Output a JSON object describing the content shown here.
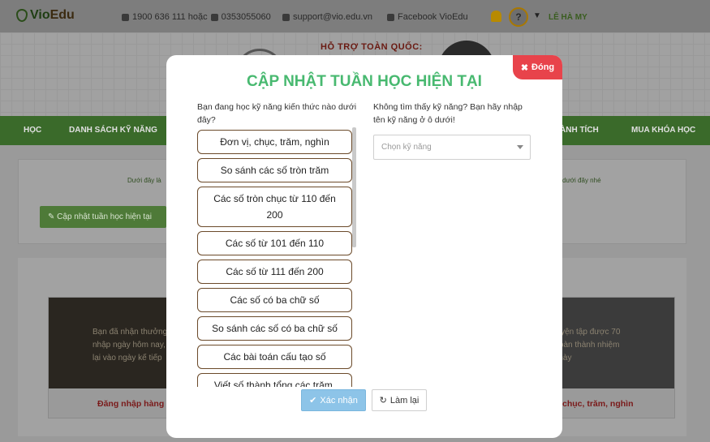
{
  "header": {
    "logo_vio": "Vio",
    "logo_edu": "Edu",
    "phone": "1900 636 111 hoặc",
    "mobile": "0353055060",
    "email": "support@vio.edu.vn",
    "facebook": "Facebook VioEdu",
    "help_mark": "?",
    "user_name": "LÊ HÀ MY"
  },
  "hero": {
    "banner_text": "HỖ TRỢ TOÀN QUỐC:"
  },
  "nav": {
    "items": [
      "HỌC",
      "DANH SÁCH KỸ NĂNG",
      "THÀNH TÍCH",
      "MUA KHÓA HỌC"
    ],
    "visible_items": [
      "HỌC",
      "DANH SÁCH KỸ NĂNG",
      "ÀNH TÍCH",
      "MUA KHÓA HỌC"
    ]
  },
  "content": {
    "intro_left": "Dưới đây là",
    "intro_right": "dưới đây nhé",
    "update_button": "Cập nhật tuần học hiện tại"
  },
  "cards": {
    "left_text": [
      "Bạn đã nhận thưởng",
      "nhập ngày hôm nay, hã",
      "lại vào ngày kế tiếp"
    ],
    "left_caption": "Đăng nhập hàng n",
    "right_text": [
      "n luyện tập được 70",
      "ể hoàn thành nhiệm",
      "vụ này"
    ],
    "right_caption": "chục, trăm, nghìn"
  },
  "modal": {
    "close_label": "Đóng",
    "title": "CẬP NHẬT TUẦN HỌC HIỆN TẠI",
    "left_question": "Bạn đang học kỹ năng kiến thức nào dưới đây?",
    "right_question": "Không tìm thấy kỹ năng? Bạn hãy nhập tên kỹ năng ở ô dưới!",
    "select_placeholder": "Chọn kỹ năng",
    "skills": [
      "Đơn vị, chục, trăm, nghìn",
      "So sánh các số tròn trăm",
      "Các số tròn chục từ 110 đến 200",
      "Các số từ 101 đến 110",
      "Các số từ 111 đến 200",
      "Các số có ba chữ số",
      "So sánh các số có ba chữ số",
      "Các bài toán cấu tạo số",
      "Viết số thành tổng các trăm,"
    ],
    "confirm_label": "Xác nhận",
    "reset_label": "Làm lại"
  },
  "colors": {
    "title_green": "#48b970",
    "close_red": "#e8434b",
    "confirm_blue": "#8dc4e8",
    "skill_border": "#6b4a2a",
    "overlay_gray": "#9a9a9a"
  }
}
